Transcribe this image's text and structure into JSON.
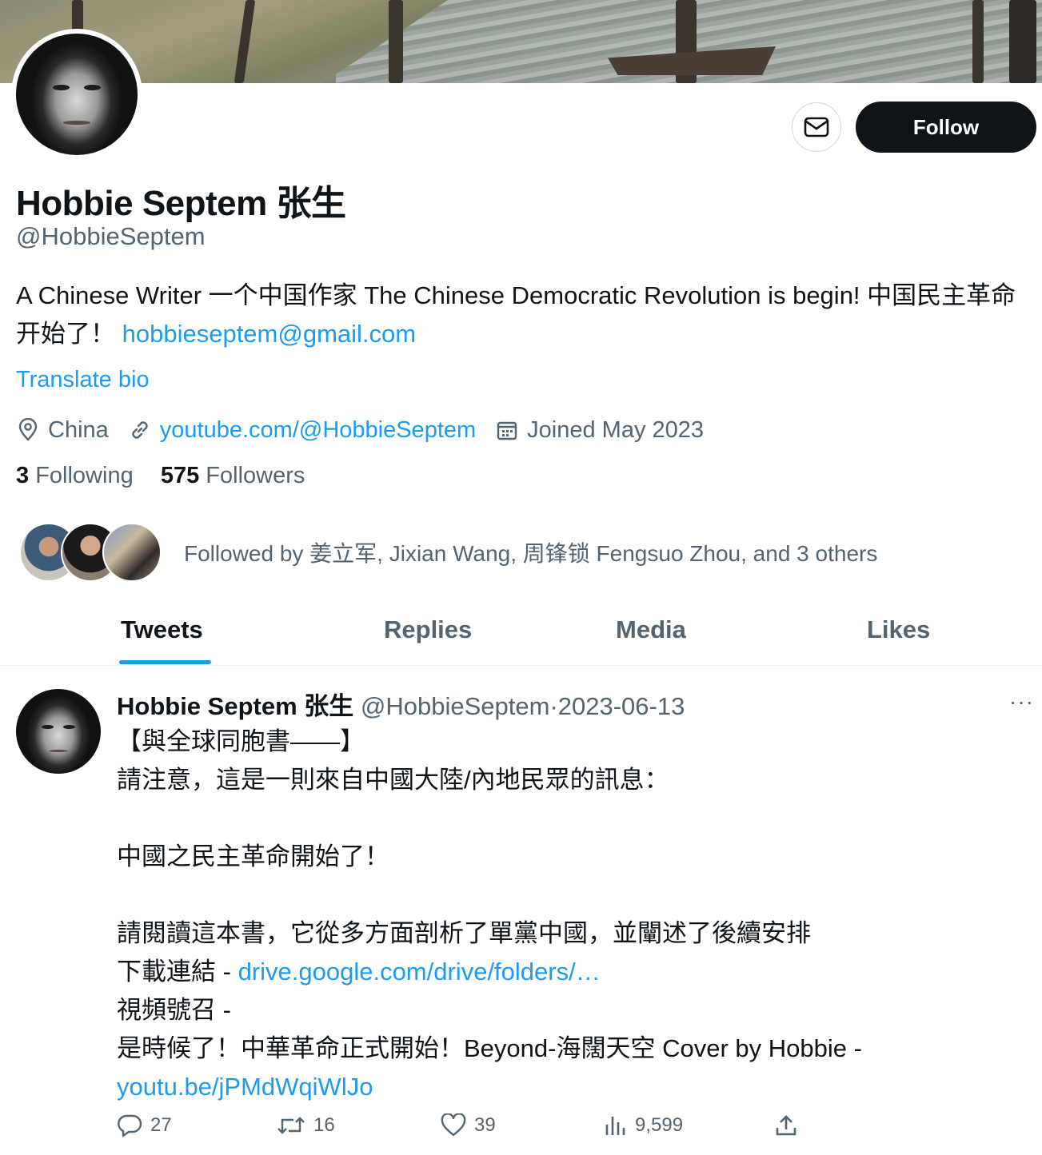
{
  "header": {
    "follow_label": "Follow"
  },
  "profile": {
    "name": "Hobbie Septem 张生",
    "handle": "@HobbieSeptem",
    "bio_text": "A Chinese Writer 一个中国作家 The Chinese Democratic Revolution is begin! 中国民主革命开始了！ ",
    "bio_email": "hobbieseptem@gmail.com",
    "translate_label": "Translate bio",
    "location": "China",
    "website": "youtube.com/@HobbieSeptem",
    "joined": "Joined May 2023",
    "following_count": "3",
    "following_label": "Following",
    "followers_count": "575",
    "followers_label": "Followers",
    "followed_by": "Followed by 姜立军, Jixian Wang, 周锋锁 Fengsuo Zhou, and 3 others"
  },
  "tabs": [
    {
      "label": "Tweets",
      "active": true
    },
    {
      "label": "Replies",
      "active": false
    },
    {
      "label": "Media",
      "active": false
    },
    {
      "label": "Likes",
      "active": false
    }
  ],
  "tweet": {
    "author_name": "Hobbie Septem 张生",
    "author_handle": "@HobbieSeptem",
    "separator": "·",
    "date": "2023-06-13",
    "more_label": "···",
    "line1": "【與全球同胞書——】",
    "line2": "請注意，這是一則來自中國大陸/內地民眾的訊息：",
    "line3": "中國之民主革命開始了！",
    "line4": "請閱讀這本書，它從多方面剖析了單黨中國，並闡述了後續安排",
    "line5_prefix": "下載連結 - ",
    "line5_link": "drive.google.com/drive/folders/…",
    "line6": "視頻號召 -",
    "line7": "是時候了！中華革命正式開始！Beyond-海闊天空 Cover by Hobbie -",
    "line8_link": "youtu.be/jPMdWqiWlJo",
    "replies": "27",
    "retweets": "16",
    "likes": "39",
    "views": "9,599"
  },
  "colors": {
    "accent": "#1d9bf0",
    "text_primary": "#0f1419",
    "text_secondary": "#536471",
    "follow_button_bg": "#0f1419"
  },
  "icons": [
    "mail-icon",
    "location-icon",
    "link-icon",
    "calendar-icon",
    "reply-icon",
    "retweet-icon",
    "like-icon",
    "views-icon",
    "share-icon"
  ]
}
